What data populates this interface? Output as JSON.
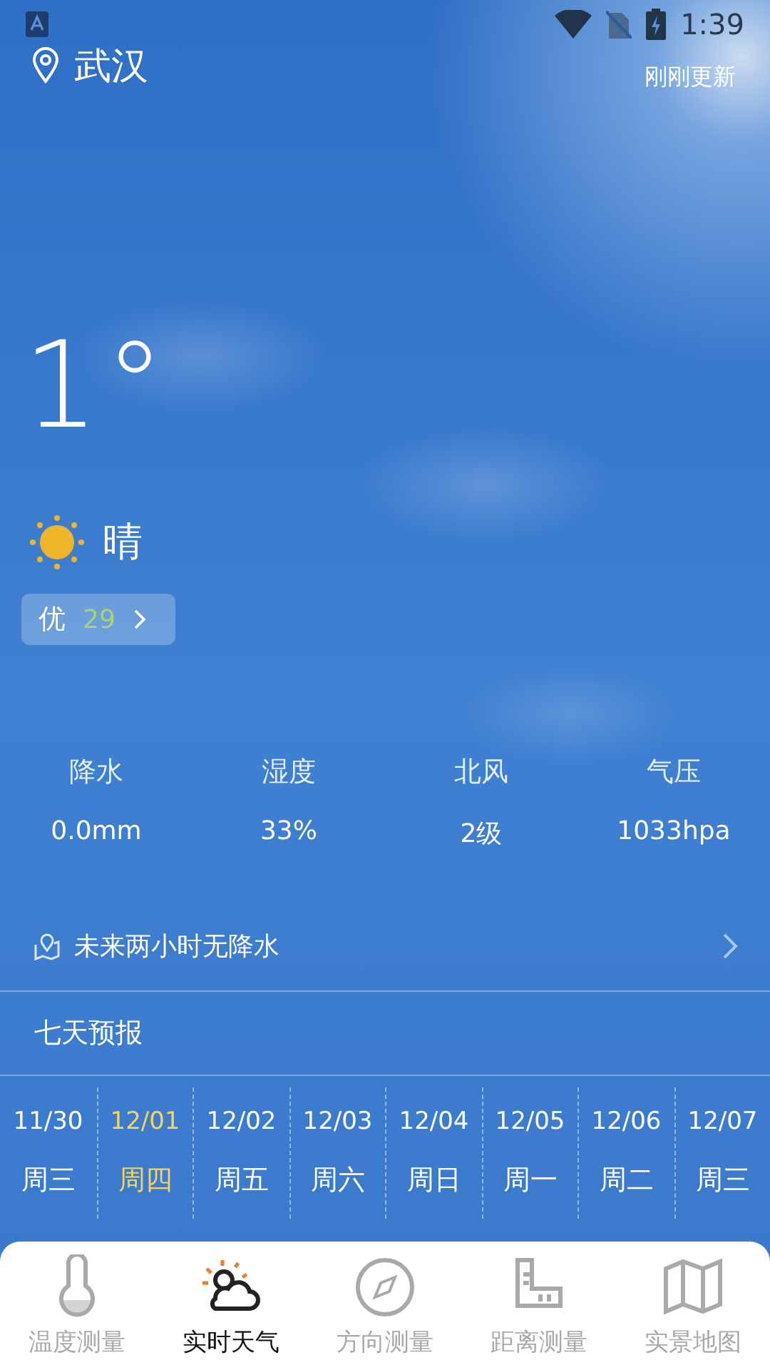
{
  "status_bar": {
    "time": "1:39"
  },
  "location": {
    "city": "武汉",
    "updated": "刚刚更新"
  },
  "current": {
    "temperature": "1°",
    "condition": "晴",
    "aqi": {
      "grade": "优",
      "value": "29"
    }
  },
  "stats": [
    {
      "label": "降水",
      "value": "0.0mm"
    },
    {
      "label": "湿度",
      "value": "33%"
    },
    {
      "label": "北风",
      "value": "2级"
    },
    {
      "label": "气压",
      "value": "1033hpa"
    }
  ],
  "rain_notice": "未来两小时无降水",
  "forecast": {
    "title": "七天预报",
    "days": [
      {
        "date": "11/30",
        "weekday": "周三",
        "selected": false
      },
      {
        "date": "12/01",
        "weekday": "周四",
        "selected": true
      },
      {
        "date": "12/02",
        "weekday": "周五",
        "selected": false
      },
      {
        "date": "12/03",
        "weekday": "周六",
        "selected": false
      },
      {
        "date": "12/04",
        "weekday": "周日",
        "selected": false
      },
      {
        "date": "12/05",
        "weekday": "周一",
        "selected": false
      },
      {
        "date": "12/06",
        "weekday": "周二",
        "selected": false
      },
      {
        "date": "12/07",
        "weekday": "周三",
        "selected": false
      }
    ]
  },
  "nav": [
    {
      "label": "温度测量",
      "selected": false
    },
    {
      "label": "实时天气",
      "selected": true
    },
    {
      "label": "方向测量",
      "selected": false
    },
    {
      "label": "距离测量",
      "selected": false
    },
    {
      "label": "实景地图",
      "selected": false
    }
  ]
}
